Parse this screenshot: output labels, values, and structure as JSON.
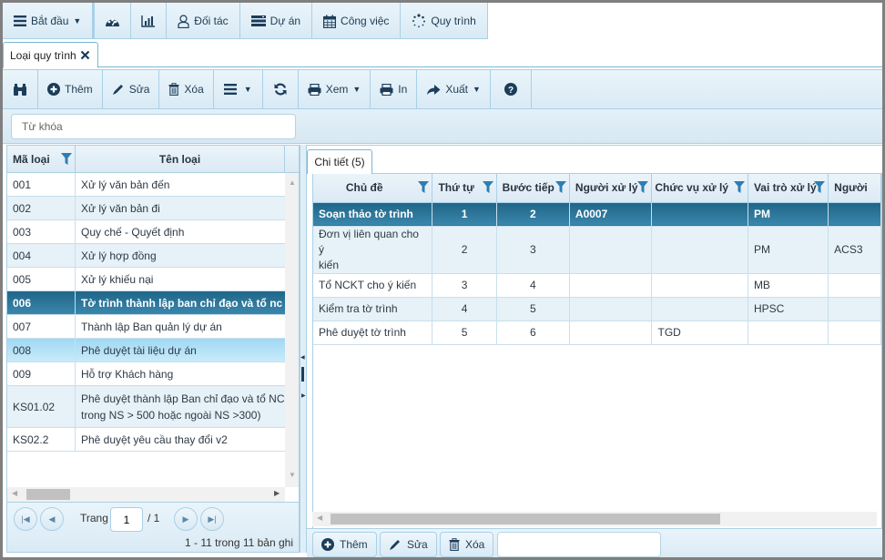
{
  "topnav": {
    "items": [
      {
        "label": "Bắt đầu",
        "icon": "menu-icon",
        "has_dropdown": true
      },
      {
        "label": "",
        "icon": "dashboard-icon"
      },
      {
        "label": "",
        "icon": "bar-chart-icon"
      },
      {
        "label": "Đối tác",
        "icon": "user-icon"
      },
      {
        "label": "Dự án",
        "icon": "server-icon"
      },
      {
        "label": "Công việc",
        "icon": "calendar-icon"
      },
      {
        "label": "Quy trình",
        "icon": "spinner-icon"
      }
    ]
  },
  "tabs": [
    {
      "label": "Loại quy trình",
      "closable": true,
      "active": true
    }
  ],
  "toolbar": {
    "find_icon": "binoculars-icon",
    "add_label": "Thêm",
    "edit_label": "Sửa",
    "delete_label": "Xóa",
    "menu_icon": "menu-icon",
    "refresh_icon": "refresh-icon",
    "view_label": "Xem",
    "print_label": "In",
    "export_label": "Xuất",
    "help_icon": "question-circle-icon"
  },
  "search": {
    "placeholder": "Từ khóa",
    "value": ""
  },
  "left_grid": {
    "columns": [
      "Mã loại",
      "Tên loại"
    ],
    "rows": [
      {
        "code": "001",
        "name": "Xử lý văn bản đến"
      },
      {
        "code": "002",
        "name": "Xử lý văn bản đi"
      },
      {
        "code": "003",
        "name": "Quy chế - Quyết định"
      },
      {
        "code": "004",
        "name": "Xử lý hợp đồng"
      },
      {
        "code": "005",
        "name": "Xử lý khiếu nại"
      },
      {
        "code": "006",
        "name": "Tờ trình thành lập ban chỉ đạo và tổ nc",
        "state": "selected"
      },
      {
        "code": "007",
        "name": "Thành lập Ban quản lý dự án"
      },
      {
        "code": "008",
        "name": "Phê duyệt tài liệu dự án",
        "state": "hover"
      },
      {
        "code": "009",
        "name": "Hỗ trợ Khách hàng"
      },
      {
        "code": "KS01.02",
        "name": "Phê duyệt thành lập Ban chỉ đạo và tổ NCKT (",
        "name2": "trong NS > 500 hoặc ngoài NS >300)"
      },
      {
        "code": "KS02.2",
        "name": "Phê duyệt yêu cầu thay đổi v2"
      }
    ],
    "pager": {
      "page_label": "Trang",
      "page": "1",
      "total_pages": "/ 1",
      "summary": "1 - 11 trong 11 bản ghi"
    }
  },
  "detail": {
    "tab_label": "Chi tiết (5)",
    "columns": [
      "Chủ đề",
      "Thứ tự",
      "Bước tiếp",
      "Người xử lý",
      "Chức vụ xử lý",
      "Vai trò xử lý",
      "Người"
    ],
    "rows": [
      [
        "Soạn thảo tờ trình",
        "1",
        "2",
        "A0007",
        "",
        "PM",
        ""
      ],
      [
        "Đơn vị liên quan cho ý|kiến",
        "2",
        "3",
        "",
        "",
        "PM",
        "ACS3"
      ],
      [
        "Tổ NCKT cho ý kiến",
        "3",
        "4",
        "",
        "",
        "MB",
        ""
      ],
      [
        "Kiểm tra tờ trình",
        "4",
        "5",
        "",
        "",
        "HPSC",
        ""
      ],
      [
        "Phê duyệt tờ trình",
        "5",
        "6",
        "",
        "TGD",
        "",
        ""
      ]
    ],
    "selected_row": 0,
    "footer": {
      "add_label": "Thêm",
      "edit_label": "Sửa",
      "delete_label": "Xóa",
      "input_value": ""
    }
  },
  "colors": {
    "accent": "#1f6688",
    "hover_row": "#b4e2f7",
    "border": "#a9d0e6",
    "filter_icon": "#2e7db3"
  }
}
